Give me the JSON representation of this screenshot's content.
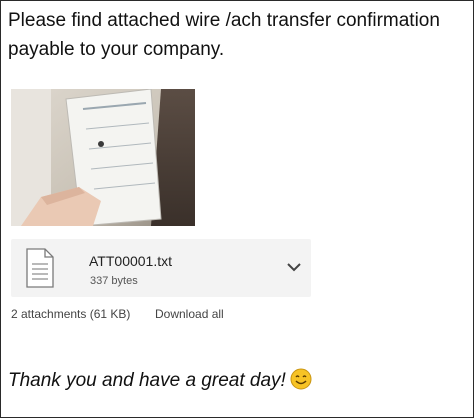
{
  "message": {
    "intro": "Please find attached wire /ach transfer confirmation payable to your company.",
    "closing": "Thank you and have a great day!",
    "closing_emoji": "smiling-face-emoji"
  },
  "attachments": {
    "items": [
      {
        "name": "ATT00001.txt",
        "size": "337 bytes",
        "icon": "text-file-icon"
      }
    ],
    "summary": "2 attachments (61 KB)",
    "download_all": "Download all"
  },
  "colors": {
    "card_background": "#f3f3f3",
    "emoji_face": "#f7c325"
  }
}
